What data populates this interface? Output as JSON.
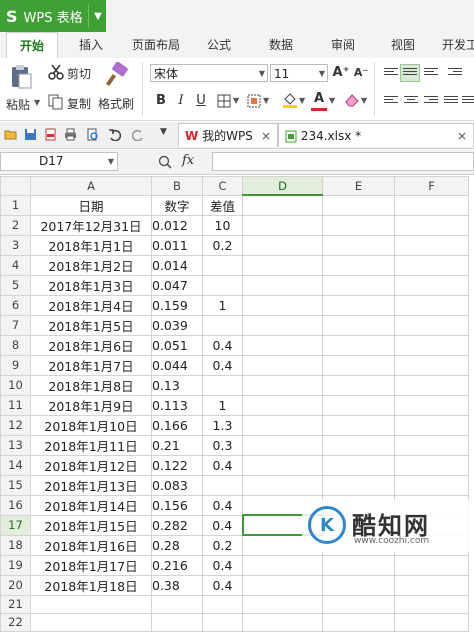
{
  "titlebar": {
    "app_logo": "S",
    "app_title": "WPS 表格",
    "dropdown": "▼"
  },
  "menu": {
    "tabs": [
      "开始",
      "插入",
      "页面布局",
      "公式",
      "数据",
      "审阅",
      "视图",
      "开发工"
    ],
    "active_index": 0
  },
  "ribbon": {
    "paste": "粘贴",
    "cut": "剪切",
    "copy": "复制",
    "format_painter": "格式刷",
    "font_name": "宋体",
    "font_size": "11",
    "grow_font": "A⁺",
    "shrink_font": "A⁻",
    "bold": "B",
    "italic": "I",
    "underline": "U",
    "font_color_label": "A",
    "accent_color": "#3fa035",
    "font_color": "#d42a2a",
    "fill_color": "#f5d400"
  },
  "quickbar": {
    "doc_tabs": [
      {
        "label": "我的WPS",
        "close": "×"
      },
      {
        "label": "234.xlsx *",
        "close": "×"
      }
    ]
  },
  "formula": {
    "name_box": "D17",
    "fx": "fx",
    "value": ""
  },
  "sheet": {
    "columns": [
      "A",
      "B",
      "C",
      "D",
      "E",
      "F"
    ],
    "rows": [
      {
        "n": "1",
        "a": "日期",
        "b": "数字",
        "c": "差值"
      },
      {
        "n": "2",
        "a": "2017年12月31日",
        "b": "0.012",
        "c": "10"
      },
      {
        "n": "3",
        "a": "2018年1月1日",
        "b": "0.011",
        "c": "0.2"
      },
      {
        "n": "4",
        "a": "2018年1月2日",
        "b": "0.014",
        "c": ""
      },
      {
        "n": "5",
        "a": "2018年1月3日",
        "b": "0.047",
        "c": ""
      },
      {
        "n": "6",
        "a": "2018年1月4日",
        "b": "0.159",
        "c": "1"
      },
      {
        "n": "7",
        "a": "2018年1月5日",
        "b": "0.039",
        "c": ""
      },
      {
        "n": "8",
        "a": "2018年1月6日",
        "b": "0.051",
        "c": "0.4"
      },
      {
        "n": "9",
        "a": "2018年1月7日",
        "b": "0.044",
        "c": "0.4"
      },
      {
        "n": "10",
        "a": "2018年1月8日",
        "b": "0.13",
        "c": ""
      },
      {
        "n": "11",
        "a": "2018年1月9日",
        "b": "0.113",
        "c": "1"
      },
      {
        "n": "12",
        "a": "2018年1月10日",
        "b": "0.166",
        "c": "1.3"
      },
      {
        "n": "13",
        "a": "2018年1月11日",
        "b": "0.21",
        "c": "0.3"
      },
      {
        "n": "14",
        "a": "2018年1月12日",
        "b": "0.122",
        "c": "0.4"
      },
      {
        "n": "15",
        "a": "2018年1月13日",
        "b": "0.083",
        "c": ""
      },
      {
        "n": "16",
        "a": "2018年1月14日",
        "b": "0.156",
        "c": "0.4"
      },
      {
        "n": "17",
        "a": "2018年1月15日",
        "b": "0.282",
        "c": "0.4"
      },
      {
        "n": "18",
        "a": "2018年1月16日",
        "b": "0.28",
        "c": "0.2"
      },
      {
        "n": "19",
        "a": "2018年1月17日",
        "b": "0.216",
        "c": "0.4"
      },
      {
        "n": "20",
        "a": "2018年1月18日",
        "b": "0.38",
        "c": "0.4"
      },
      {
        "n": "21",
        "a": "",
        "b": "",
        "c": ""
      },
      {
        "n": "22",
        "a": "",
        "b": "",
        "c": ""
      }
    ],
    "active_row": "17",
    "active_col": "D"
  },
  "watermark": {
    "logo": "K",
    "text": "酷知网",
    "url": "www.coozhi.com"
  }
}
